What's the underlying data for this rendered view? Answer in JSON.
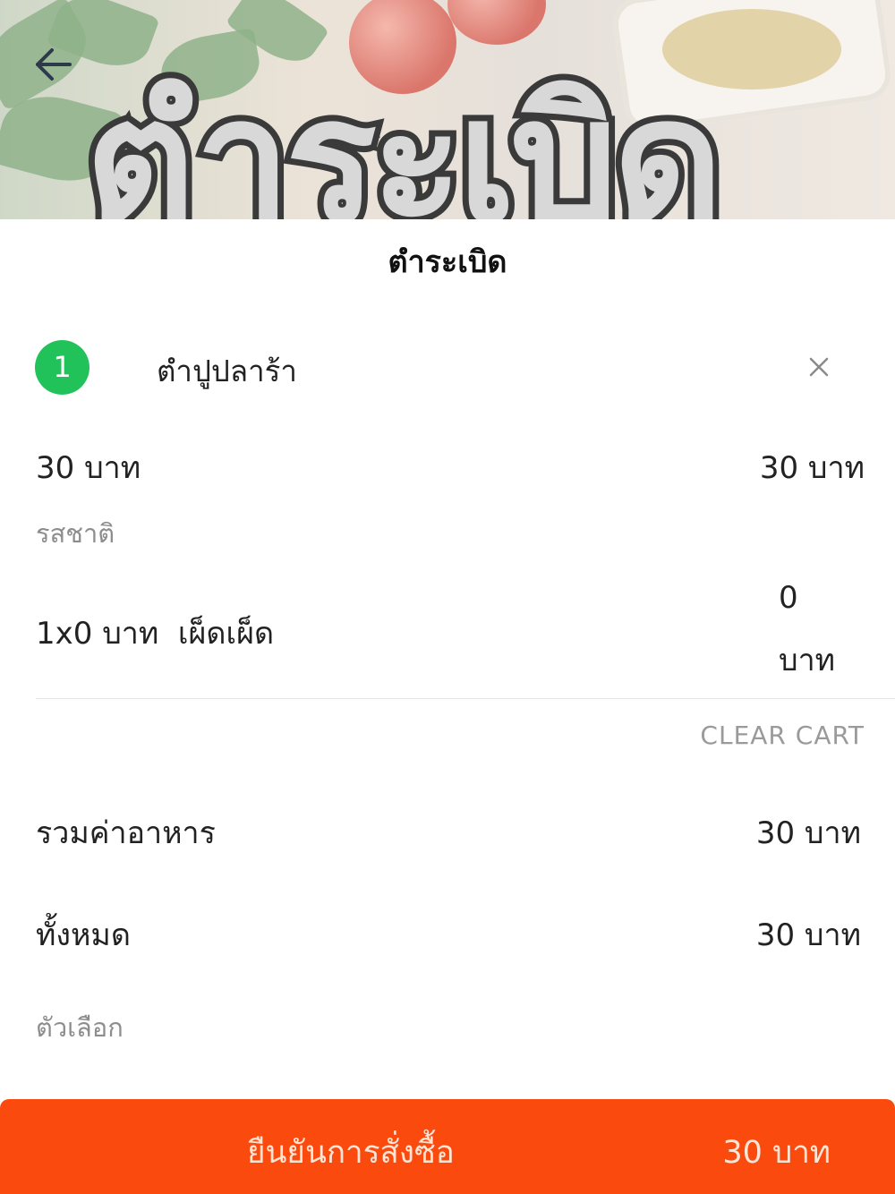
{
  "banner": {
    "title_text": "ตำระเบิด"
  },
  "header": {
    "back_icon": "arrow-left-icon",
    "shop_title": "ตำระเบิด"
  },
  "cart_item": {
    "quantity": "1",
    "name": "ตำปูปลาร้า",
    "remove_icon": "close-icon",
    "unit_price": "30 บาท",
    "line_price": "30 บาท",
    "option_group_label": "รสชาติ",
    "option_line": "1x0 บาท  เผ็ดเผ็ด",
    "option_price_value": "0",
    "option_price_unit": "บาท"
  },
  "cart_actions": {
    "clear_label": "CLEAR CART"
  },
  "summary": {
    "food_total_label": "รวมค่าอาหาร",
    "food_total_value": "30 บาท",
    "grand_total_label": "ทั้งหมด",
    "grand_total_value": "30 บาท",
    "options_label": "ตัวเลือก"
  },
  "confirm": {
    "label": "ยืนยันการสั่งซื้อ",
    "total": "30 บาท",
    "color": "#fb4a0e"
  },
  "colors": {
    "badge": "#21c25a",
    "muted_text": "#8d8d8d"
  }
}
